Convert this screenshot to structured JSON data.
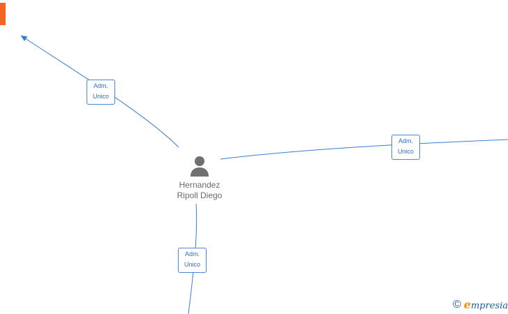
{
  "person": {
    "name_line1": "Hernandez",
    "name_line2": "Ripoll Diego",
    "icon": "person-icon"
  },
  "edges": [
    {
      "label_line1": "Adm.",
      "label_line2": "Unico"
    },
    {
      "label_line1": "Adm.",
      "label_line2": "Unico"
    },
    {
      "label_line1": "Adm.",
      "label_line2": "Unico"
    }
  ],
  "branding": {
    "copyright": "©",
    "logo_initial": "e",
    "logo_rest": "mpresia"
  },
  "colors": {
    "edge": "#3a7bd5",
    "label_border": "#4a86d8",
    "label_text": "#2f6fc4",
    "person": "#707070",
    "company_icon": "#f26522",
    "brand_accent": "#f29100",
    "brand_text": "#1e5a9a"
  }
}
